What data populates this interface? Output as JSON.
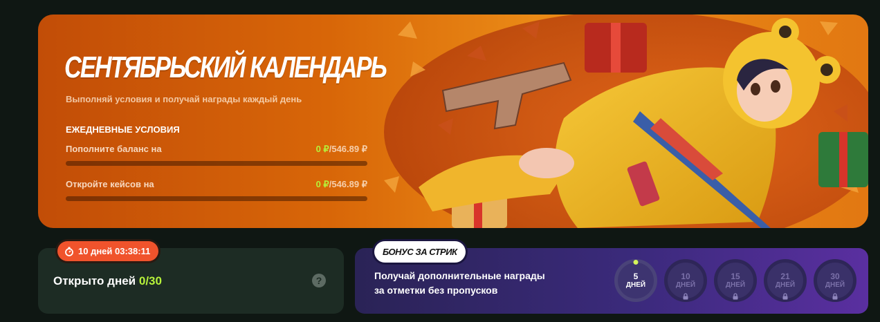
{
  "hero": {
    "title": "СЕНТЯБРЬСКИЙ КАЛЕНДАРЬ",
    "subtitle": "Выполняй условия и получай награды каждый день",
    "conditions_header": "ЕЖЕДНЕВНЫЕ УСЛОВИЯ",
    "conditions": [
      {
        "label": "Пополните баланс на",
        "current": "0 ₽",
        "separator": "/",
        "total": "546.89 ₽",
        "progress": 0
      },
      {
        "label": "Откройте кейсов на",
        "current": "0 ₽",
        "separator": "/",
        "total": "546.89 ₽",
        "progress": 0
      }
    ],
    "accent_color": "#b6f23a"
  },
  "streak_card": {
    "timer_icon": "stopwatch-icon",
    "timer_text": "10 дней 03:38:11",
    "opened_label": "Открыто дней",
    "opened_value": "0/30",
    "help_icon": "question-icon",
    "help_glyph": "?"
  },
  "bonus_card": {
    "badge": "БОНУС ЗА СТРИК",
    "text_line1": "Получай дополнительные награды",
    "text_line2": "за отметки без пропусков",
    "steps": [
      {
        "num": "5",
        "label": "ДНЕЙ",
        "locked": false,
        "active": true
      },
      {
        "num": "10",
        "label": "ДНЕЙ",
        "locked": true,
        "active": false
      },
      {
        "num": "15",
        "label": "ДНЕЙ",
        "locked": true,
        "active": false
      },
      {
        "num": "21",
        "label": "ДНЕЙ",
        "locked": true,
        "active": false
      },
      {
        "num": "30",
        "label": "ДНЕЙ",
        "locked": true,
        "active": false
      }
    ],
    "lock_icon": "lock-icon"
  }
}
